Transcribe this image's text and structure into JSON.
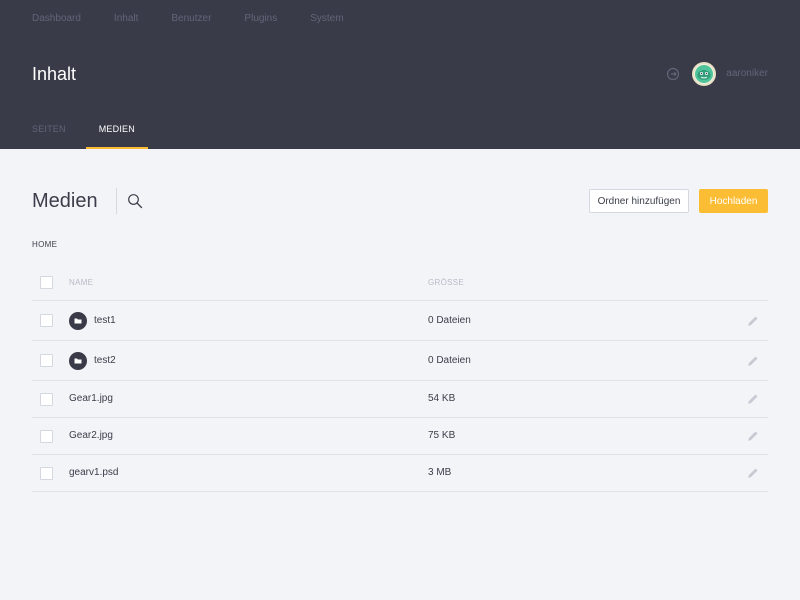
{
  "topnav": [
    "Dashboard",
    "Inhalt",
    "Benutzer",
    "Plugins",
    "System"
  ],
  "page_title": "Inhalt",
  "user": {
    "name": "aaroniker",
    "icon": "user-avatar"
  },
  "tabs": [
    {
      "label": "SEITEN",
      "active": false
    },
    {
      "label": "MEDIEN",
      "active": true
    }
  ],
  "section": {
    "title": "Medien",
    "add_folder_label": "Ordner hinzufügen",
    "upload_label": "Hochladen"
  },
  "breadcrumb": "HOME",
  "table": {
    "columns": {
      "name": "NAME",
      "size": "GRÖSSE"
    },
    "rows": [
      {
        "type": "folder",
        "name": "test1",
        "size": "0 Dateien"
      },
      {
        "type": "folder",
        "name": "test2",
        "size": "0 Dateien"
      },
      {
        "type": "file",
        "name": "Gear1.jpg",
        "size": "54 KB"
      },
      {
        "type": "file",
        "name": "Gear2.jpg",
        "size": "75 KB"
      },
      {
        "type": "file",
        "name": "gearv1.psd",
        "size": "3 MB"
      }
    ]
  },
  "colors": {
    "header_bg": "#393b48",
    "accent": "#fbbd34",
    "page_bg": "#f3f4f8"
  }
}
